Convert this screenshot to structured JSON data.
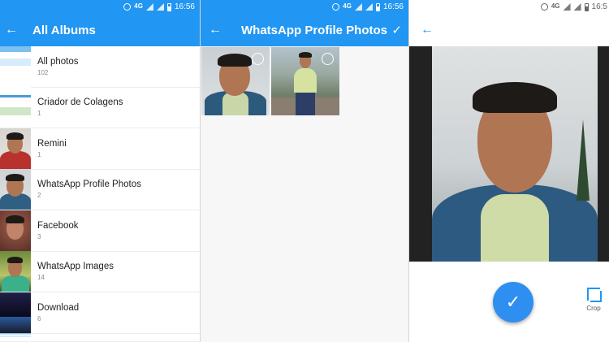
{
  "status_bar": {
    "time": "16:56",
    "network": "4G"
  },
  "status_bar_pane3": {
    "time": "16:5",
    "network": "4G"
  },
  "albums_screen": {
    "title": "All Albums",
    "albums": [
      {
        "name": "All photos",
        "count": "102"
      },
      {
        "name": "Criador de Colagens",
        "count": "1"
      },
      {
        "name": "Remini",
        "count": "1"
      },
      {
        "name": "WhatsApp Profile Photos",
        "count": "2"
      },
      {
        "name": "Facebook",
        "count": "3"
      },
      {
        "name": "WhatsApp Images",
        "count": "14"
      },
      {
        "name": "Download",
        "count": "6"
      }
    ]
  },
  "album_screen": {
    "title": "WhatsApp Profile Photos"
  },
  "crop_screen": {
    "crop_label": "Crop"
  },
  "colors": {
    "primary": "#2196f3",
    "fab": "#2f8ff0"
  },
  "icons": [
    "back-arrow-icon",
    "check-icon",
    "crop-icon",
    "alarm-icon",
    "signal-icon",
    "battery-icon"
  ]
}
